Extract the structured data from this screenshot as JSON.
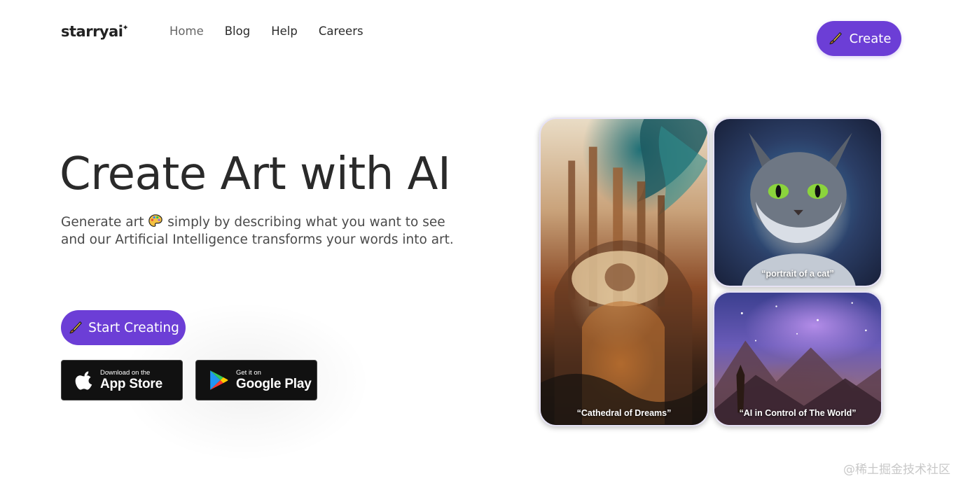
{
  "header": {
    "logo_text": "starryai",
    "logo_spark": "✦",
    "nav": [
      {
        "label": "Home",
        "active": true
      },
      {
        "label": "Blog",
        "active": false
      },
      {
        "label": "Help",
        "active": false
      },
      {
        "label": "Careers",
        "active": false
      }
    ],
    "create_label": "Create"
  },
  "hero": {
    "title": "Create Art with AI",
    "subtitle_part1": "Generate art",
    "subtitle_part2": "simply by describing what you want to see and our Artificial Intelligence transforms your words into art.",
    "start_label": "Start Creating"
  },
  "stores": {
    "apple": {
      "small": "Download on the",
      "big": "App Store"
    },
    "google": {
      "small": "Get it on",
      "big": "Google Play"
    }
  },
  "gallery": [
    {
      "caption": "“Cathedral of Dreams”"
    },
    {
      "caption": "“portrait of a cat”"
    },
    {
      "caption": "“AI in Control of The World”"
    }
  ],
  "watermark": "@稀土掘金技术社区",
  "colors": {
    "accent": "#6c3ed6",
    "store_bg": "#111111"
  },
  "icons": {
    "brush": "paintbrush-icon",
    "palette": "palette-emoji-icon",
    "apple": "apple-logo-icon",
    "google_play": "google-play-logo-icon"
  }
}
